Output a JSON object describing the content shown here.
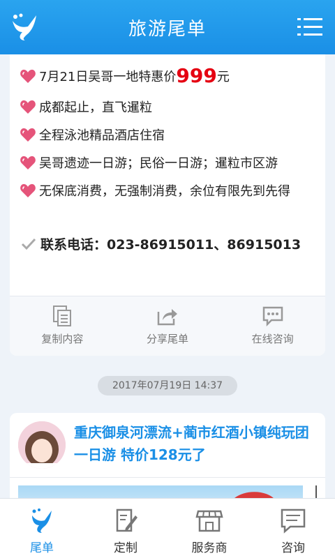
{
  "header": {
    "title": "旅游尾单"
  },
  "post1": {
    "lines": [
      {
        "prefix": "7月21日吴哥一地特惠价",
        "price": "999",
        "suffix": "元"
      },
      {
        "text": "成都起止，直飞暹粒"
      },
      {
        "text": "全程泳池精品酒店住宿"
      },
      {
        "text": "吴哥遗迹一日游；民俗一日游；暹粒市区游"
      },
      {
        "text": "无保底消费，无强制消费，余位有限先到先得"
      }
    ],
    "phone": "联系电话：023-86915011、86915013",
    "actions": [
      {
        "label": "复制内容",
        "icon": "copy-icon"
      },
      {
        "label": "分享尾单",
        "icon": "share-icon"
      },
      {
        "label": "在线咨询",
        "icon": "chat-icon"
      }
    ]
  },
  "timestamp": "2017年07月19日 14:37",
  "post2": {
    "title": "重庆御泉河漂流+蔺市红酒小镇纯玩团一日游 特价128元了"
  },
  "tabs": [
    {
      "label": "尾单",
      "icon": "logo-icon",
      "active": true
    },
    {
      "label": "定制",
      "icon": "edit-icon",
      "active": false
    },
    {
      "label": "服务商",
      "icon": "store-icon",
      "active": false
    },
    {
      "label": "咨询",
      "icon": "message-icon",
      "active": false
    }
  ],
  "colors": {
    "brand": "#1a8fe6",
    "price": "#e50012",
    "heart": "#e5547a"
  }
}
